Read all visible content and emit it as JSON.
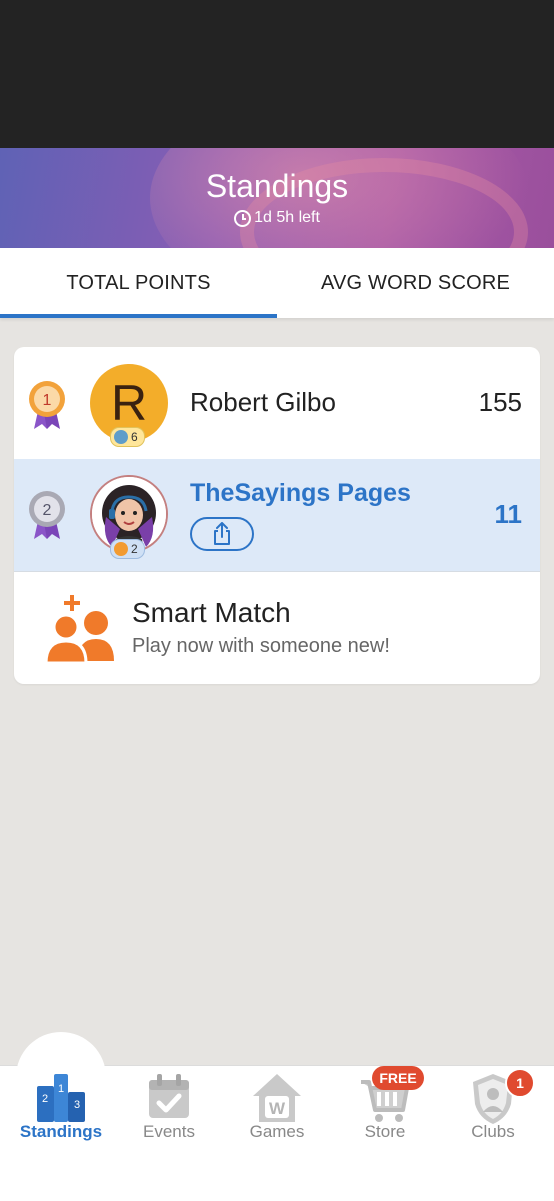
{
  "header": {
    "title": "Standings",
    "timer": "1d 5h left"
  },
  "tabs": [
    {
      "label": "TOTAL POINTS",
      "active": true
    },
    {
      "label": "AVG WORD SCORE",
      "active": false
    }
  ],
  "standings": [
    {
      "rank": "1",
      "name": "Robert Gilbo",
      "avatar_letter": "R",
      "badge_count": "6",
      "score": "155",
      "medal": "gold-medal-icon"
    },
    {
      "rank": "2",
      "name": "TheSayings Pages",
      "badge_count": "2",
      "score": "11",
      "medal": "silver-medal-icon",
      "is_current_user": true
    }
  ],
  "smart_match": {
    "title": "Smart Match",
    "subtitle": "Play now with someone new!"
  },
  "bottom_nav": {
    "items": [
      {
        "label": "Standings",
        "icon": "podium-icon",
        "active": true
      },
      {
        "label": "Events",
        "icon": "calendar-icon"
      },
      {
        "label": "Games",
        "icon": "house-w-icon"
      },
      {
        "label": "Store",
        "icon": "cart-icon",
        "badge": "FREE"
      },
      {
        "label": "Clubs",
        "icon": "shield-icon",
        "badge": "1"
      }
    ]
  },
  "colors": {
    "accent": "#2c74c7",
    "badge_red": "#e04a2f",
    "smart_orange": "#f07a2a"
  }
}
